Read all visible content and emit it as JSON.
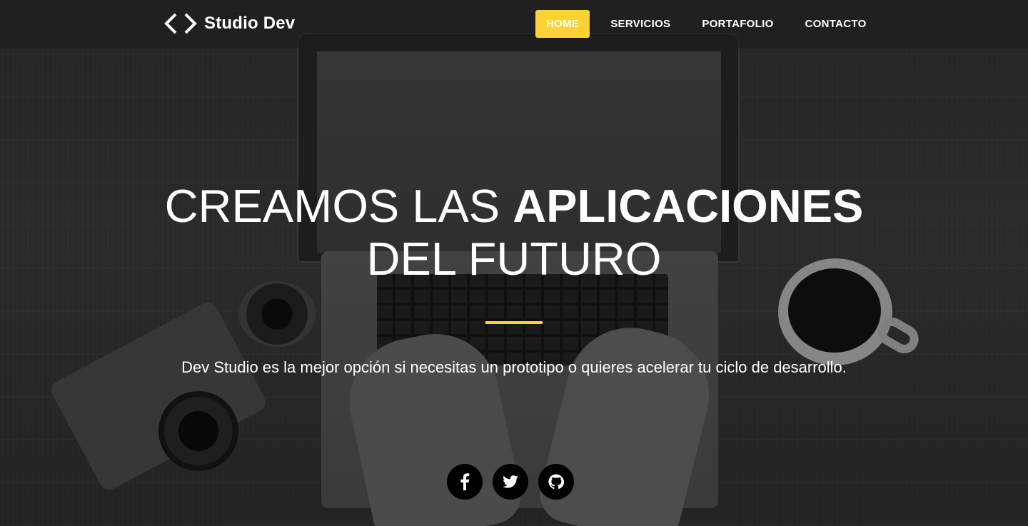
{
  "brand": {
    "name": "Studio Dev",
    "icon": "code-brackets-icon"
  },
  "nav": {
    "items": [
      {
        "label": "HOME",
        "active": true
      },
      {
        "label": "SERVICIOS",
        "active": false
      },
      {
        "label": "PORTAFOLIO",
        "active": false
      },
      {
        "label": "CONTACTO",
        "active": false
      }
    ]
  },
  "hero": {
    "title_part1": "CREAMOS LAS ",
    "title_strong": "APLICACIONES",
    "title_line2": "DEL FUTURO",
    "subtitle": "Dev Studio es la mejor opción si necesitas un prototipo o quieres acelerar tu ciclo de desarrollo."
  },
  "social": [
    {
      "icon": "facebook-icon"
    },
    {
      "icon": "twitter-icon"
    },
    {
      "icon": "github-icon"
    }
  ],
  "colors": {
    "accent": "#fed136",
    "navbar_bg": "rgba(28,28,28,0.55)",
    "text": "#ffffff",
    "social_bg": "#000000"
  }
}
